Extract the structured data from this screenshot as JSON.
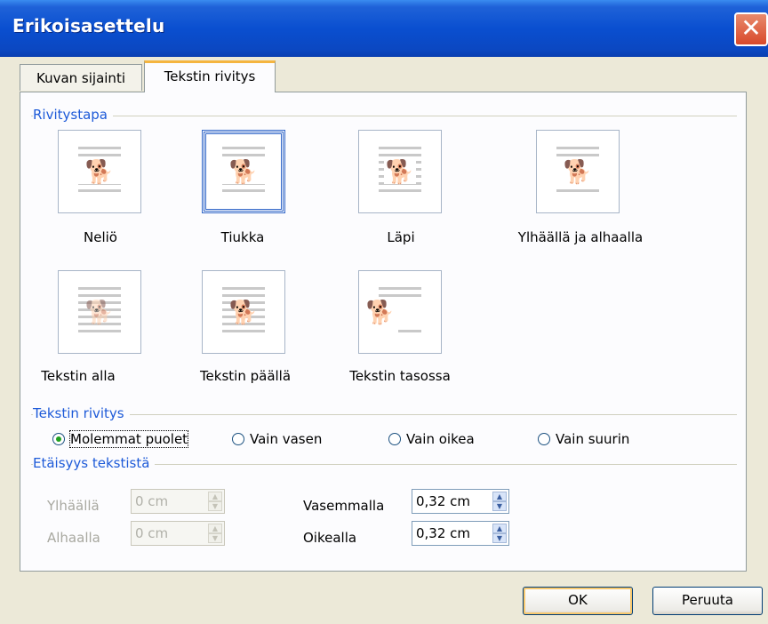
{
  "window": {
    "title": "Erikoisasettelu",
    "close": "✕"
  },
  "tabs": [
    {
      "label": "Kuvan sijainti"
    },
    {
      "label": "Tekstin rivitys"
    }
  ],
  "groups": {
    "style": "Rivitystapa",
    "wrap_text": "Tekstin rivitys",
    "distance": "Etäisyys tekstistä"
  },
  "wrap_styles": [
    {
      "label": "Neliö"
    },
    {
      "label": "Tiukka"
    },
    {
      "label": "Läpi"
    },
    {
      "label": "Ylhäällä ja alhaalla"
    },
    {
      "label": "Tekstin alla"
    },
    {
      "label": "Tekstin päällä"
    },
    {
      "label": "Tekstin tasossa"
    }
  ],
  "wrap_options": [
    {
      "label": "Molemmat puolet",
      "selected": true
    },
    {
      "label": "Vain vasen",
      "selected": false
    },
    {
      "label": "Vain oikea",
      "selected": false
    },
    {
      "label": "Vain suurin",
      "selected": false
    }
  ],
  "distance": {
    "top_label": "Ylhäällä",
    "top_value": "0 cm",
    "bottom_label": "Alhaalla",
    "bottom_value": "0 cm",
    "left_label": "Vasemmalla",
    "left_value": "0,32 cm",
    "right_label": "Oikealla",
    "right_value": "0,32 cm"
  },
  "buttons": {
    "ok": "OK",
    "cancel": "Peruuta"
  },
  "icons": {
    "dog": "🐕"
  }
}
